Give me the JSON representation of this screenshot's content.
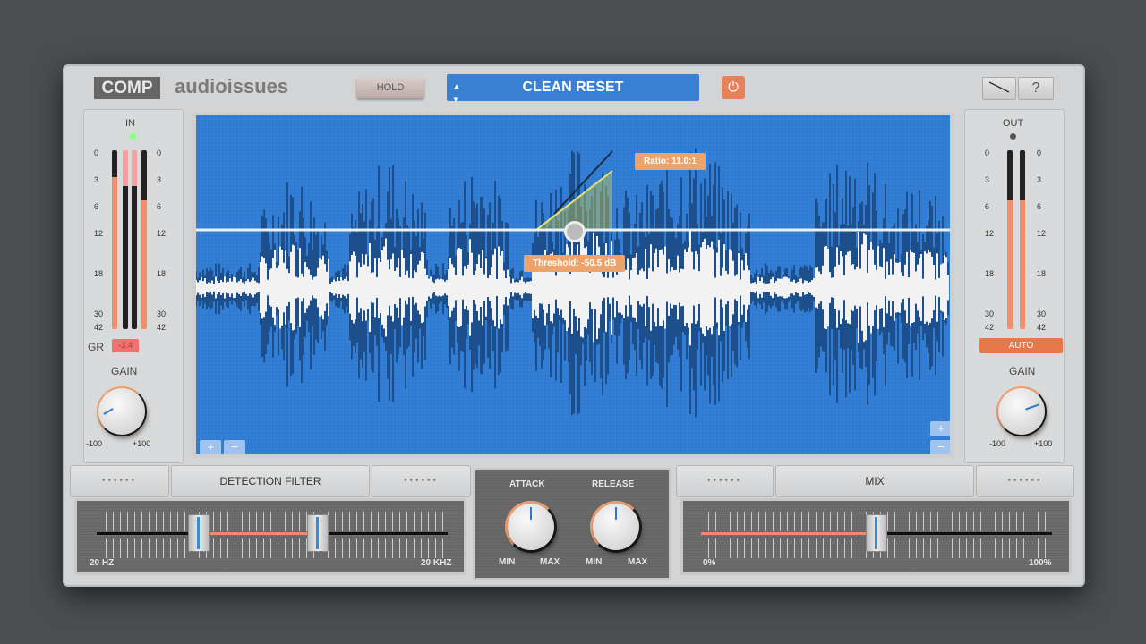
{
  "header": {
    "logo": "COMP",
    "brand": "audioissues",
    "hold_label": "HOLD",
    "preset": "CLEAN RESET",
    "power_icon": "power-icon",
    "curve_icon": "curve-icon",
    "help_label": "?"
  },
  "input": {
    "label": "IN",
    "scale_left": [
      "0",
      "3",
      "6",
      "12",
      "18",
      "30",
      "42"
    ],
    "scale_right": [
      "0",
      "3",
      "6",
      "12",
      "18",
      "30",
      "42"
    ],
    "gr_label": "GR",
    "gr_value": "-3.4",
    "gain_label": "GAIN",
    "gain_min": "-100",
    "gain_max": "+100"
  },
  "output": {
    "label": "OUT",
    "scale_left": [
      "0",
      "3",
      "6",
      "12",
      "18",
      "30",
      "42"
    ],
    "scale_right": [
      "0",
      "3",
      "6",
      "12",
      "18",
      "30",
      "42"
    ],
    "auto_label": "AUTO",
    "gain_label": "GAIN",
    "gain_min": "-100",
    "gain_max": "+100"
  },
  "display": {
    "ratio_label": "Ratio: 11.0:1",
    "threshold_label": "Threshold: -50.5 dB",
    "zoom_in": "+",
    "zoom_out": "−"
  },
  "detection": {
    "title": "DETECTION FILTER",
    "dots": "••••••",
    "min_label": "20 HZ",
    "max_label": "20 KHZ"
  },
  "dynamics": {
    "attack_label": "ATTACK",
    "release_label": "RELEASE",
    "min": "MIN",
    "max": "MAX"
  },
  "mix": {
    "title": "MIX",
    "dots": "••••••",
    "min_label": "0%",
    "max_label": "100%",
    "value_percent": 50
  },
  "colors": {
    "accent": "#e8825a",
    "display": "#2f7bd2"
  }
}
